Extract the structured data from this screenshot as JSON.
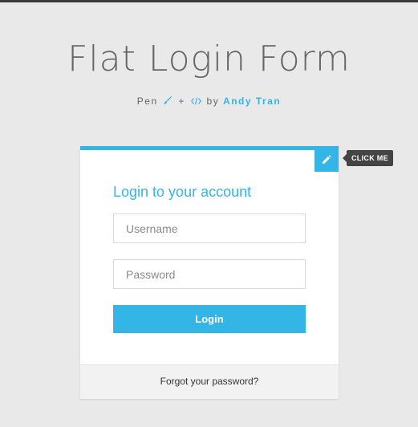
{
  "page": {
    "title": "Flat Login Form",
    "credits": {
      "pen_text": "Pen",
      "plus": "+",
      "by_text": "by",
      "author": "Andy Tran",
      "brush_icon": "paintbrush-icon",
      "code_icon": "code-icon"
    }
  },
  "card": {
    "toggle_icon": "pencil-icon",
    "tooltip": "CLICK ME",
    "form_title": "Login to your account",
    "username_placeholder": "Username",
    "password_placeholder": "Password",
    "login_label": "Login",
    "forgot_link": "Forgot your password?"
  },
  "colors": {
    "accent": "#33b5e5",
    "background": "#e9e9e9",
    "title_text": "#666666",
    "tooltip_bg": "#444444"
  }
}
